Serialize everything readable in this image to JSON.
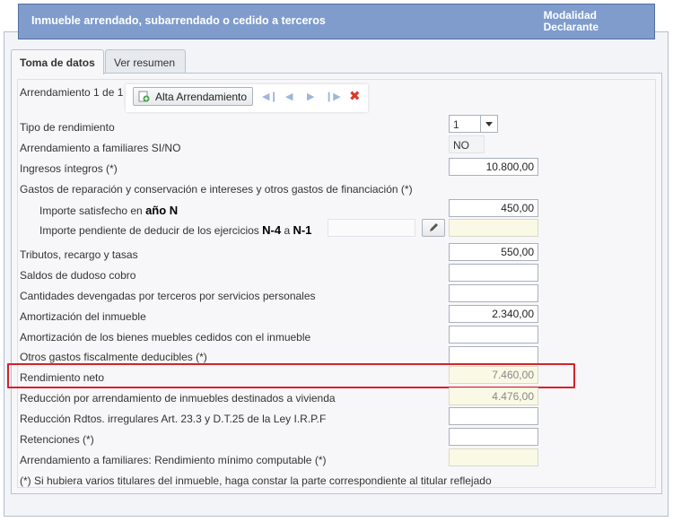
{
  "header": {
    "title": "Inmueble arrendado, subarrendado o cedido a terceros",
    "modalidad_line1": "Modalidad",
    "modalidad_line2": "Declarante"
  },
  "tabs": [
    {
      "label": "Toma de datos",
      "active": true
    },
    {
      "label": "Ver resumen",
      "active": false
    }
  ],
  "toolbar": {
    "record_label": "Arrendamiento 1 de 1",
    "add_button": "Alta Arrendamiento"
  },
  "form": {
    "tipo_rendimiento": {
      "label": "Tipo de rendimiento",
      "value": "1"
    },
    "familiares": {
      "label": "Arrendamiento a familiares SI/NO",
      "value": "NO"
    },
    "ingresos": {
      "label": "Ingresos íntegros (*)",
      "value": "10.800,00"
    },
    "gastos_header": "Gastos de reparación y conservación e intereses y otros gastos de financiación (*)",
    "importe_satisfecho": {
      "label": "Importe satisfecho en ",
      "strong": "año N",
      "value": "450,00"
    },
    "importe_pendiente": {
      "label": "Importe pendiente de deducir de los ejercicios ",
      "strong1": "N-4",
      "mid": " a ",
      "strong2": "N-1",
      "value": ""
    },
    "tributos": {
      "label": "Tributos, recargo y tasas",
      "value": "550,00"
    },
    "saldos": {
      "label": "Saldos de dudoso cobro",
      "value": ""
    },
    "cantidades": {
      "label": "Cantidades devengadas por terceros por servicios personales",
      "value": ""
    },
    "amortizacion_inmueble": {
      "label": "Amortización del inmueble",
      "value": "2.340,00"
    },
    "amortizacion_bienes": {
      "label": "Amortización de los bienes muebles cedidos con el inmueble",
      "value": ""
    },
    "otros_gastos": {
      "label": "Otros gastos fiscalmente deducibles (*)",
      "value": ""
    },
    "rendimiento_neto": {
      "label": "Rendimiento neto",
      "value": "7.460,00"
    },
    "reduccion_vivienda": {
      "label": "Reducción por arrendamiento de inmuebles destinados a vivienda",
      "value": "4.476,00"
    },
    "reduccion_irregulares": {
      "label": "Reducción Rdtos. irregulares Art. 23.3 y D.T.25 de la Ley I.R.P.F",
      "value": ""
    },
    "retenciones": {
      "label": "Retenciones (*)",
      "value": ""
    },
    "minimo_computable": {
      "label": "Arrendamiento a familiares: Rendimiento mínimo computable (*)",
      "value": ""
    },
    "footnote": "(*) Si hubiera varios titulares del inmueble, haga constar la parte correspondiente al titular reflejado"
  },
  "colors": {
    "header_bg": "#7f9ccd",
    "highlight": "#d8202a",
    "readonly_bg": "#f9f9e6"
  }
}
